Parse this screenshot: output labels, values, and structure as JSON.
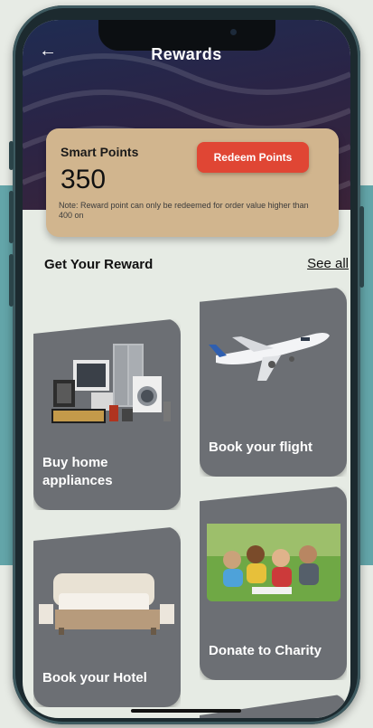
{
  "header": {
    "title": "Rewards"
  },
  "points_card": {
    "label": "Smart Points",
    "value": "350",
    "redeem_label": "Redeem Points",
    "note": "Note: Reward point can only be redeemed for order value higher than 400 on"
  },
  "section": {
    "title": "Get Your Reward",
    "see_all": "See all"
  },
  "rewards": [
    {
      "label": "Buy home appliances",
      "icon": "home-appliances-image"
    },
    {
      "label": "Book your flight",
      "icon": "airplane-image"
    },
    {
      "label": "Book your Hotel",
      "icon": "bed-image"
    },
    {
      "label": "Donate to Charity",
      "icon": "children-image"
    }
  ],
  "colors": {
    "header_dark": "#1f2c52",
    "card_gold": "#d1b58e",
    "accent_red": "#e04634",
    "tile_gray": "#6c6f74",
    "teal_band": "#63a5a9"
  }
}
